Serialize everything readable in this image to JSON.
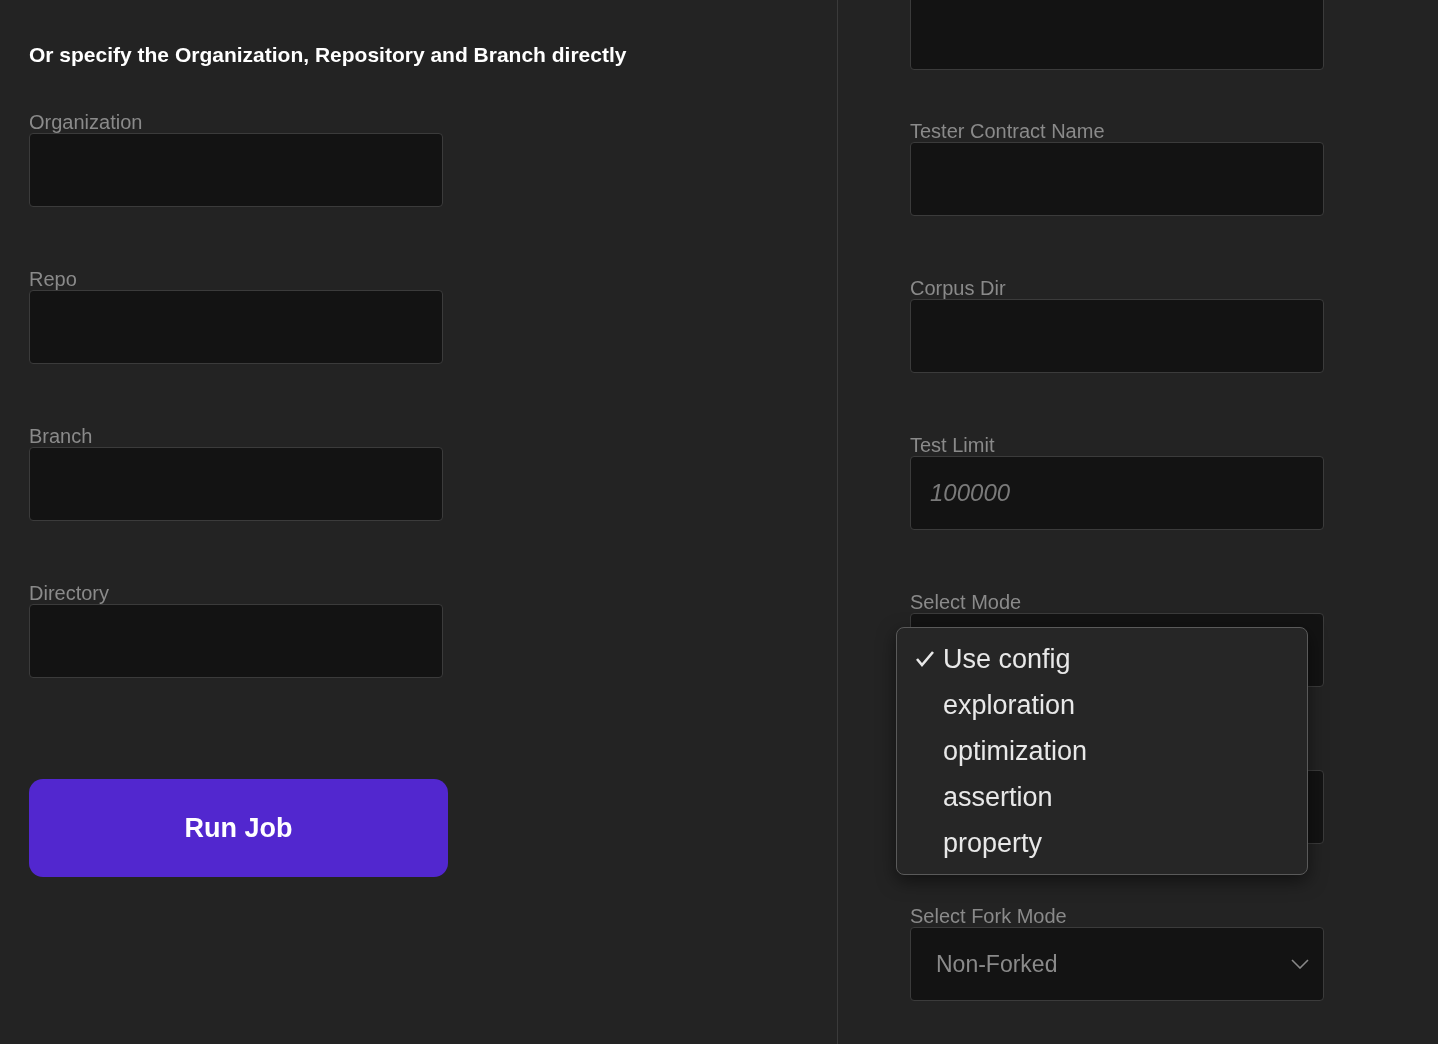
{
  "left": {
    "heading": "Or specify the Organization, Repository and Branch directly",
    "fields": [
      {
        "label": "Organization"
      },
      {
        "label": "Repo"
      },
      {
        "label": "Branch"
      },
      {
        "label": "Directory"
      }
    ],
    "button": "Run Job"
  },
  "right": {
    "fields": [
      {
        "kind": "input"
      },
      {
        "kind": "input",
        "label": "Tester Contract Name"
      },
      {
        "kind": "input",
        "label": "Corpus Dir"
      },
      {
        "kind": "input",
        "label": "Test Limit",
        "placeholder": "100000"
      },
      {
        "kind": "select",
        "label": "Select Mode",
        "expanded": true,
        "options": [
          {
            "label": "Use config",
            "selected": true
          },
          {
            "label": "exploration",
            "selected": false
          },
          {
            "label": "optimization",
            "selected": false
          },
          {
            "label": "assertion",
            "selected": false
          },
          {
            "label": "property",
            "selected": false
          }
        ]
      },
      {
        "kind": "input"
      },
      {
        "kind": "select",
        "label": "Select Fork Mode",
        "expanded": false,
        "value": "Non-Forked"
      }
    ]
  }
}
